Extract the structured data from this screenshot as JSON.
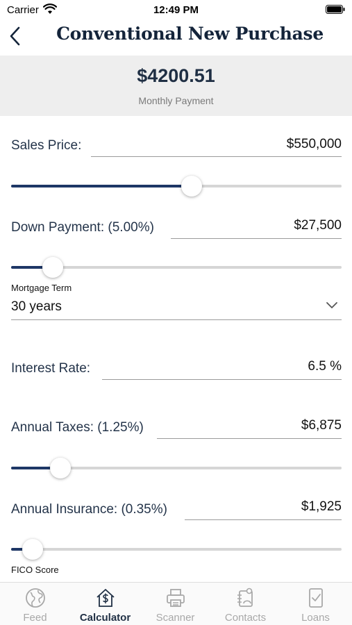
{
  "status_bar": {
    "carrier": "Carrier",
    "time": "12:49 PM"
  },
  "nav": {
    "title": "Conventional New Purchase"
  },
  "summary": {
    "payment": "$4200.51",
    "payment_label": "Monthly Payment"
  },
  "sales_price": {
    "label": "Sales Price:",
    "value": "$550,000",
    "slider_fraction": 0.55
  },
  "down_payment": {
    "label": "Down Payment: (5.00%)",
    "value": "$27,500",
    "slider_fraction": 0.1
  },
  "mortgage_term": {
    "label": "Mortgage Term",
    "value": "30 years"
  },
  "interest_rate": {
    "label": "Interest Rate:",
    "value": "6.5 %"
  },
  "annual_taxes": {
    "label": "Annual Taxes: (1.25%)",
    "value": "$6,875",
    "slider_fraction": 0.125
  },
  "annual_insurance": {
    "label": "Annual Insurance: (0.35%)",
    "value": "$1,925",
    "slider_fraction": 0.035
  },
  "fico": {
    "label": "FICO Score"
  },
  "tabs": [
    {
      "label": "Feed",
      "icon": "globe-icon",
      "active": false
    },
    {
      "label": "Calculator",
      "icon": "house-dollar-icon",
      "active": true
    },
    {
      "label": "Scanner",
      "icon": "printer-icon",
      "active": false
    },
    {
      "label": "Contacts",
      "icon": "contacts-icon",
      "active": false
    },
    {
      "label": "Loans",
      "icon": "document-check-icon",
      "active": false
    }
  ],
  "colors": {
    "accent": "#1e3766",
    "track": "#d6d6d6",
    "summary_bg": "#eeeeee",
    "tab_inactive": "#a8a8a8"
  }
}
